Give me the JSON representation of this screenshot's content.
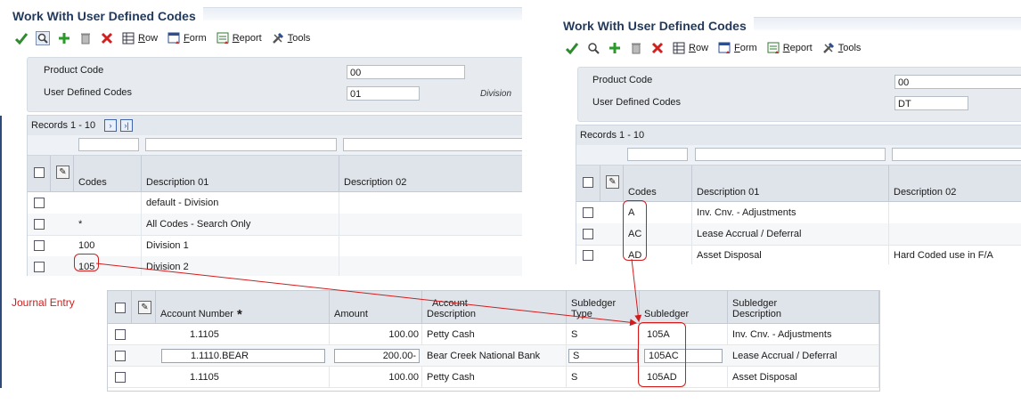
{
  "left_window": {
    "title": "Work With User Defined Codes",
    "toolbar": {
      "row": "Row",
      "form": "Form",
      "report": "Report",
      "tools": "Tools"
    },
    "fields": {
      "product_code_label": "Product Code",
      "product_code_value": "00",
      "udc_label": "User Defined Codes",
      "udc_value": "01",
      "udc_description": "Division"
    },
    "records_label": "Records 1 - 10",
    "columns": {
      "codes": "Codes",
      "desc1": "Description 01",
      "desc2": "Description 02"
    },
    "rows": [
      {
        "code": "",
        "desc1": "default - Division",
        "desc2": ""
      },
      {
        "code": "*",
        "desc1": "All Codes - Search Only",
        "desc2": ""
      },
      {
        "code": "100",
        "desc1": "Division 1",
        "desc2": ""
      },
      {
        "code": "105",
        "desc1": "Division 2",
        "desc2": ""
      }
    ]
  },
  "right_window": {
    "title": "Work With User Defined Codes",
    "toolbar": {
      "row": "Row",
      "form": "Form",
      "report": "Report",
      "tools": "Tools"
    },
    "fields": {
      "product_code_label": "Product Code",
      "product_code_value": "00",
      "udc_label": "User Defined Codes",
      "udc_value": "DT"
    },
    "records_label": "Records 1 - 10",
    "columns": {
      "codes": "Codes",
      "desc1": "Description 01",
      "desc2": "Description 02"
    },
    "rows": [
      {
        "code": "A",
        "desc1": "Inv. Cnv. - Adjustments",
        "desc2": ""
      },
      {
        "code": "AC",
        "desc1": "Lease Accrual / Deferral",
        "desc2": ""
      },
      {
        "code": "AD",
        "desc1": "Asset Disposal",
        "desc2": "Hard Coded use in F/A"
      }
    ]
  },
  "journal_entry": {
    "label": "Journal Entry",
    "columns": {
      "account_number": "Account Number",
      "required_mark": "*",
      "amount": "Amount",
      "account_description_1": "Account",
      "account_description_2": "Description",
      "subledger_type_1": "Subledger",
      "subledger_type_2": "Type",
      "subledger": "Subledger",
      "subledger_description_1": "Subledger",
      "subledger_description_2": "Description"
    },
    "rows": [
      {
        "account": "1.1105",
        "amount": "100.00",
        "description": "Petty Cash",
        "sub_type": "S",
        "subledger": "105A",
        "sub_desc": "Inv. Cnv. - Adjustments"
      },
      {
        "account": "1.1110.BEAR",
        "amount": "200.00-",
        "description": "Bear Creek National Bank",
        "sub_type": "S",
        "subledger": "105AC",
        "sub_desc": "Lease Accrual / Deferral"
      },
      {
        "account": "1.1105",
        "amount": "100.00",
        "description": "Petty Cash",
        "sub_type": "S",
        "subledger": "105AD",
        "sub_desc": "Asset Disposal"
      }
    ]
  },
  "colors": {
    "title_text": "#233a5c",
    "callout_red": "#d21c1c",
    "header_panel": "#e7ebf0",
    "grid_header": "#dfe4ea"
  },
  "icons": [
    "check-icon",
    "search-icon",
    "add-icon",
    "delete-icon",
    "close-icon",
    "row-menu-icon",
    "form-menu-icon",
    "report-menu-icon",
    "tools-menu-icon",
    "attachment-icon",
    "next-page-icon",
    "last-page-icon"
  ]
}
